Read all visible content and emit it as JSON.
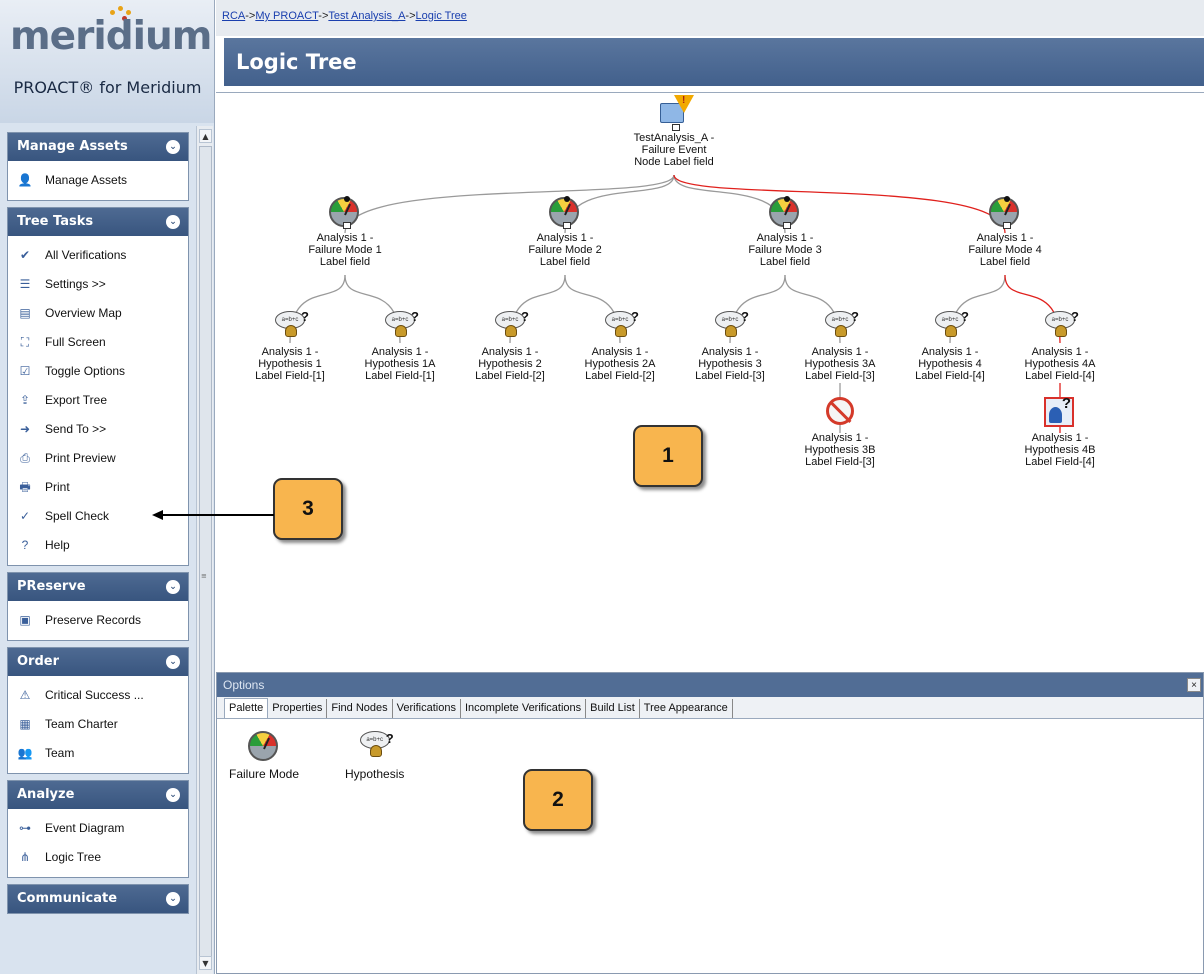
{
  "logo": {
    "wordmark": "meridium",
    "product": "PROACT® for Meridium"
  },
  "breadcrumb": {
    "items": [
      "RCA",
      "My PROACT",
      "Test Analysis_A",
      "Logic Tree"
    ],
    "separator": "->"
  },
  "page_title": "Logic Tree",
  "sidebar": {
    "panels": [
      {
        "title": "Manage Assets",
        "items": [
          {
            "label": "Manage Assets",
            "icon": "manage-assets-icon"
          }
        ]
      },
      {
        "title": "Tree Tasks",
        "items": [
          {
            "label": "All Verifications",
            "icon": "verifications-icon"
          },
          {
            "label": "Settings  >>",
            "icon": "settings-icon"
          },
          {
            "label": "Overview Map",
            "icon": "overview-map-icon"
          },
          {
            "label": "Full Screen",
            "icon": "full-screen-icon"
          },
          {
            "label": "Toggle Options",
            "icon": "toggle-options-icon"
          },
          {
            "label": "Export Tree",
            "icon": "export-tree-icon"
          },
          {
            "label": "Send To >>",
            "icon": "send-to-icon"
          },
          {
            "label": "Print Preview",
            "icon": "print-preview-icon"
          },
          {
            "label": "Print",
            "icon": "print-icon"
          },
          {
            "label": "Spell Check",
            "icon": "spell-check-icon"
          },
          {
            "label": "Help",
            "icon": "help-icon"
          }
        ]
      },
      {
        "title": "PReserve",
        "items": [
          {
            "label": "Preserve Records",
            "icon": "preserve-records-icon"
          }
        ]
      },
      {
        "title": "Order",
        "items": [
          {
            "label": "Critical Success ...",
            "icon": "critical-success-icon"
          },
          {
            "label": "Team Charter",
            "icon": "team-charter-icon"
          },
          {
            "label": "Team",
            "icon": "team-icon"
          }
        ]
      },
      {
        "title": "Analyze",
        "items": [
          {
            "label": "Event Diagram",
            "icon": "event-diagram-icon"
          },
          {
            "label": "Logic Tree",
            "icon": "logic-tree-icon"
          }
        ]
      },
      {
        "title": "Communicate",
        "items": []
      }
    ]
  },
  "tree": {
    "root": "TestAnalysis_A -\nFailure Event\nNode Label field",
    "modes": [
      "Analysis 1 -\nFailure Mode 1\nLabel field",
      "Analysis 1 -\nFailure Mode 2\nLabel field",
      "Analysis 1 -\nFailure Mode 3\nLabel field",
      "Analysis 1 -\nFailure Mode 4\nLabel field"
    ],
    "hypotheses": [
      "Analysis 1 -\nHypothesis 1\nLabel Field-[1]",
      "Analysis 1 -\nHypothesis 1A\nLabel Field-[1]",
      "Analysis 1 -\nHypothesis 2\nLabel Field-[2]",
      "Analysis 1 -\nHypothesis 2A\nLabel Field-[2]",
      "Analysis 1 -\nHypothesis 3\nLabel Field-[3]",
      "Analysis 1 -\nHypothesis 3A\nLabel Field-[3]",
      "Analysis 1 -\nHypothesis 4\nLabel Field-[4]",
      "Analysis 1 -\nHypothesis 4A\nLabel Field-[4]"
    ],
    "h3b": "Analysis 1 -\nHypothesis 3B\nLabel Field-[3]",
    "h4b": "Analysis 1 -\nHypothesis 4B\nLabel Field-[4]",
    "colors": {
      "link": "#9a9a9a",
      "highlight": "#e0211d"
    }
  },
  "callouts": {
    "c1": "1",
    "c2": "2",
    "c3": "3"
  },
  "options": {
    "title": "Options",
    "close": "×",
    "tabs": [
      "Palette",
      "Properties",
      "Find Nodes",
      "Verifications",
      "Incomplete Verifications",
      "Build List",
      "Tree Appearance"
    ],
    "palette": [
      "Failure Mode",
      "Hypothesis"
    ]
  }
}
